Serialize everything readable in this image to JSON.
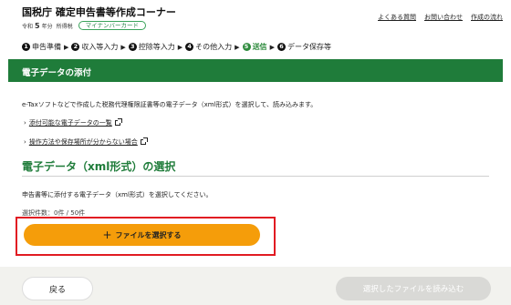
{
  "header": {
    "title": "国税庁 確定申告書等作成コーナー",
    "era": "令和",
    "year": "5",
    "year_suffix": "年分",
    "tax_type": "所得税",
    "mynumber_badge": "マイナンバーカード",
    "links": [
      "よくある質問",
      "お問い合わせ",
      "作成の流れ"
    ]
  },
  "steps": [
    {
      "num": "1",
      "label": "申告準備",
      "active": false
    },
    {
      "num": "2",
      "label": "収入等入力",
      "active": false
    },
    {
      "num": "3",
      "label": "控除等入力",
      "active": false
    },
    {
      "num": "4",
      "label": "その他入力",
      "active": false
    },
    {
      "num": "5",
      "label": "送信",
      "active": true
    },
    {
      "num": "6",
      "label": "データ保存等",
      "active": false
    }
  ],
  "main": {
    "bar_title": "電子データの添付",
    "intro": "e-Taxソフトなどで作成した税務代理権限証書等の電子データ（xml形式）を選択して、読み込みます。",
    "links": [
      "添付可能な電子データの一覧",
      "操作方法や保存場所が分からない場合"
    ],
    "section_title": "電子データ（xml形式）の選択",
    "description": "申告書等に添付する電子データ（xml形式）を選択してください。",
    "count_text": "選択件数：0件 / 50件",
    "select_button": "ファイルを選択する"
  },
  "footer": {
    "back_button": "戻る",
    "read_button": "選択したファイルを読み込む"
  },
  "colors": {
    "brand_green": "#1f7c3a",
    "accent_orange": "#f59d0a",
    "highlight_red": "#e11b22"
  }
}
